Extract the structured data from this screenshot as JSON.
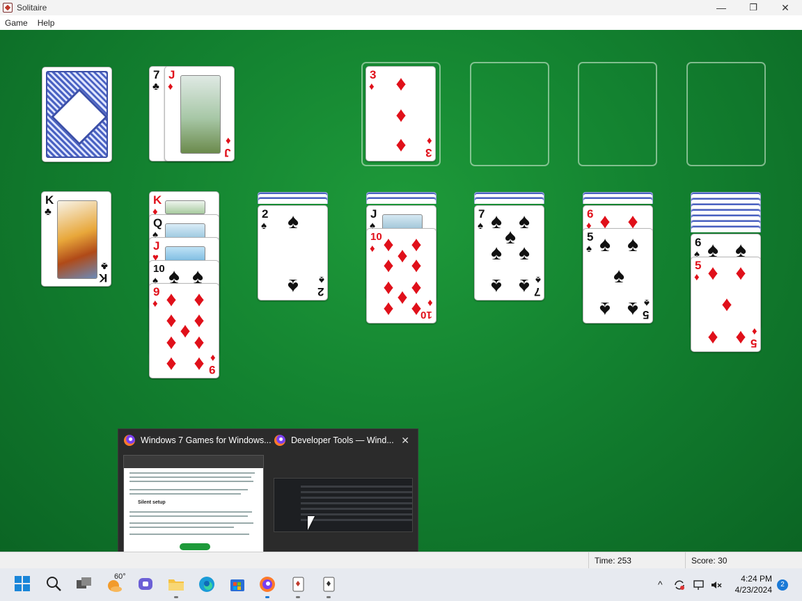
{
  "window": {
    "title": "Solitaire",
    "controls": {
      "minimize": "—",
      "restore": "❐",
      "close": "✕"
    }
  },
  "menu": {
    "items": [
      "Game",
      "Help"
    ]
  },
  "board": {
    "stock": {
      "cards": "face-down"
    },
    "waste": [
      {
        "rank": "7",
        "suit": "♣",
        "color": "blk"
      },
      {
        "rank": "J",
        "suit": "♦",
        "color": "red"
      }
    ],
    "foundations": [
      {
        "rank": "3",
        "suit": "♦",
        "color": "red"
      },
      null,
      null,
      null
    ],
    "tableau": [
      {
        "hidden": 0,
        "face_up": [
          {
            "rank": "K",
            "suit": "♣",
            "color": "blk"
          }
        ]
      },
      {
        "hidden": 0,
        "face_up": [
          {
            "rank": "K",
            "suit": "♦",
            "color": "red"
          },
          {
            "rank": "Q",
            "suit": "♠",
            "color": "blk"
          },
          {
            "rank": "J",
            "suit": "♥",
            "color": "red"
          },
          {
            "rank": "10",
            "suit": "♠",
            "color": "blk"
          },
          {
            "rank": "9",
            "suit": "♦",
            "color": "red"
          }
        ]
      },
      {
        "hidden": 2,
        "face_up": [
          {
            "rank": "2",
            "suit": "♠",
            "color": "blk"
          }
        ]
      },
      {
        "hidden": 2,
        "face_up": [
          {
            "rank": "J",
            "suit": "♠",
            "color": "blk"
          },
          {
            "rank": "10",
            "suit": "♦",
            "color": "red"
          }
        ]
      },
      {
        "hidden": 2,
        "face_up": [
          {
            "rank": "7",
            "suit": "♠",
            "color": "blk"
          }
        ]
      },
      {
        "hidden": 2,
        "face_up": [
          {
            "rank": "6",
            "suit": "♦",
            "color": "red"
          },
          {
            "rank": "5",
            "suit": "♠",
            "color": "blk"
          }
        ]
      },
      {
        "hidden": 6,
        "face_up": [
          {
            "rank": "6",
            "suit": "♠",
            "color": "blk"
          },
          {
            "rank": "5",
            "suit": "♦",
            "color": "red"
          }
        ]
      }
    ]
  },
  "task_preview": {
    "windows": [
      {
        "title": "Windows 7 Games for Windows...",
        "icon": "firefox-icon",
        "page_heading": "Silent setup"
      },
      {
        "title": "Developer Tools — Wind...",
        "icon": "firefox-icon"
      }
    ],
    "close": "✕"
  },
  "status": {
    "time_label": "Time:",
    "time_value": "253",
    "score_label": "Score:",
    "score_value": "30"
  },
  "taskbar": {
    "weather": "60°",
    "clock_time": "4:24 PM",
    "clock_date": "4/23/2024",
    "notification_count": "2",
    "tray": {
      "chevron": "^"
    }
  },
  "colors": {
    "felt": "#138230",
    "red_suit": "#e0101a",
    "card_back": "#4a62c2",
    "taskbar": "#e7eaf0"
  }
}
